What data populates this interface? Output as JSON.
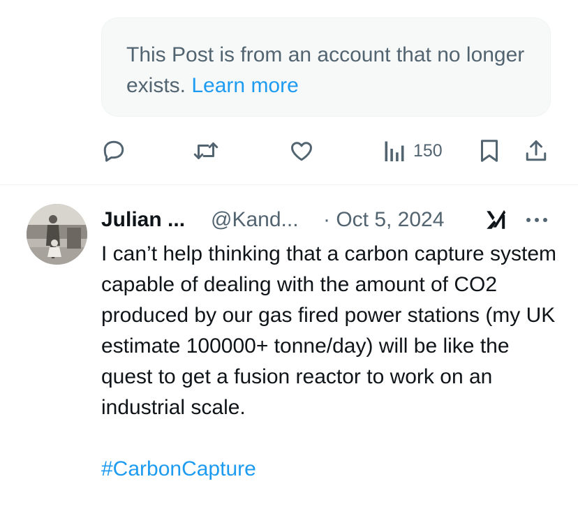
{
  "notice": {
    "text": "This Post is from an account that no longer exists.",
    "link": "Learn more"
  },
  "actions": {
    "reply_icon": "reply-icon",
    "repost_icon": "repost-icon",
    "like_icon": "heart-icon",
    "views_icon": "views-bar-chart-icon",
    "views_count": "150",
    "bookmark_icon": "bookmark-icon",
    "share_icon": "share-icon"
  },
  "post": {
    "author_name": "Julian ...",
    "handle": "@Kand...",
    "date": "· Oct 5, 2024",
    "grok_icon": "grok-icon",
    "more_icon": "more-options-icon",
    "body": "I can’t help thinking that a carbon capture system capable of dealing with the amount of CO2 produced by our gas fired power stations (my UK estimate 100000+ tonne/day) will be like the quest to get a fusion reactor to work on an industrial scale.",
    "hashtag": "#CarbonCapture"
  },
  "colors": {
    "text_primary": "#0f1419",
    "text_secondary": "#536471",
    "link": "#1d9bf0",
    "notice_bg": "#f7f9f9"
  }
}
